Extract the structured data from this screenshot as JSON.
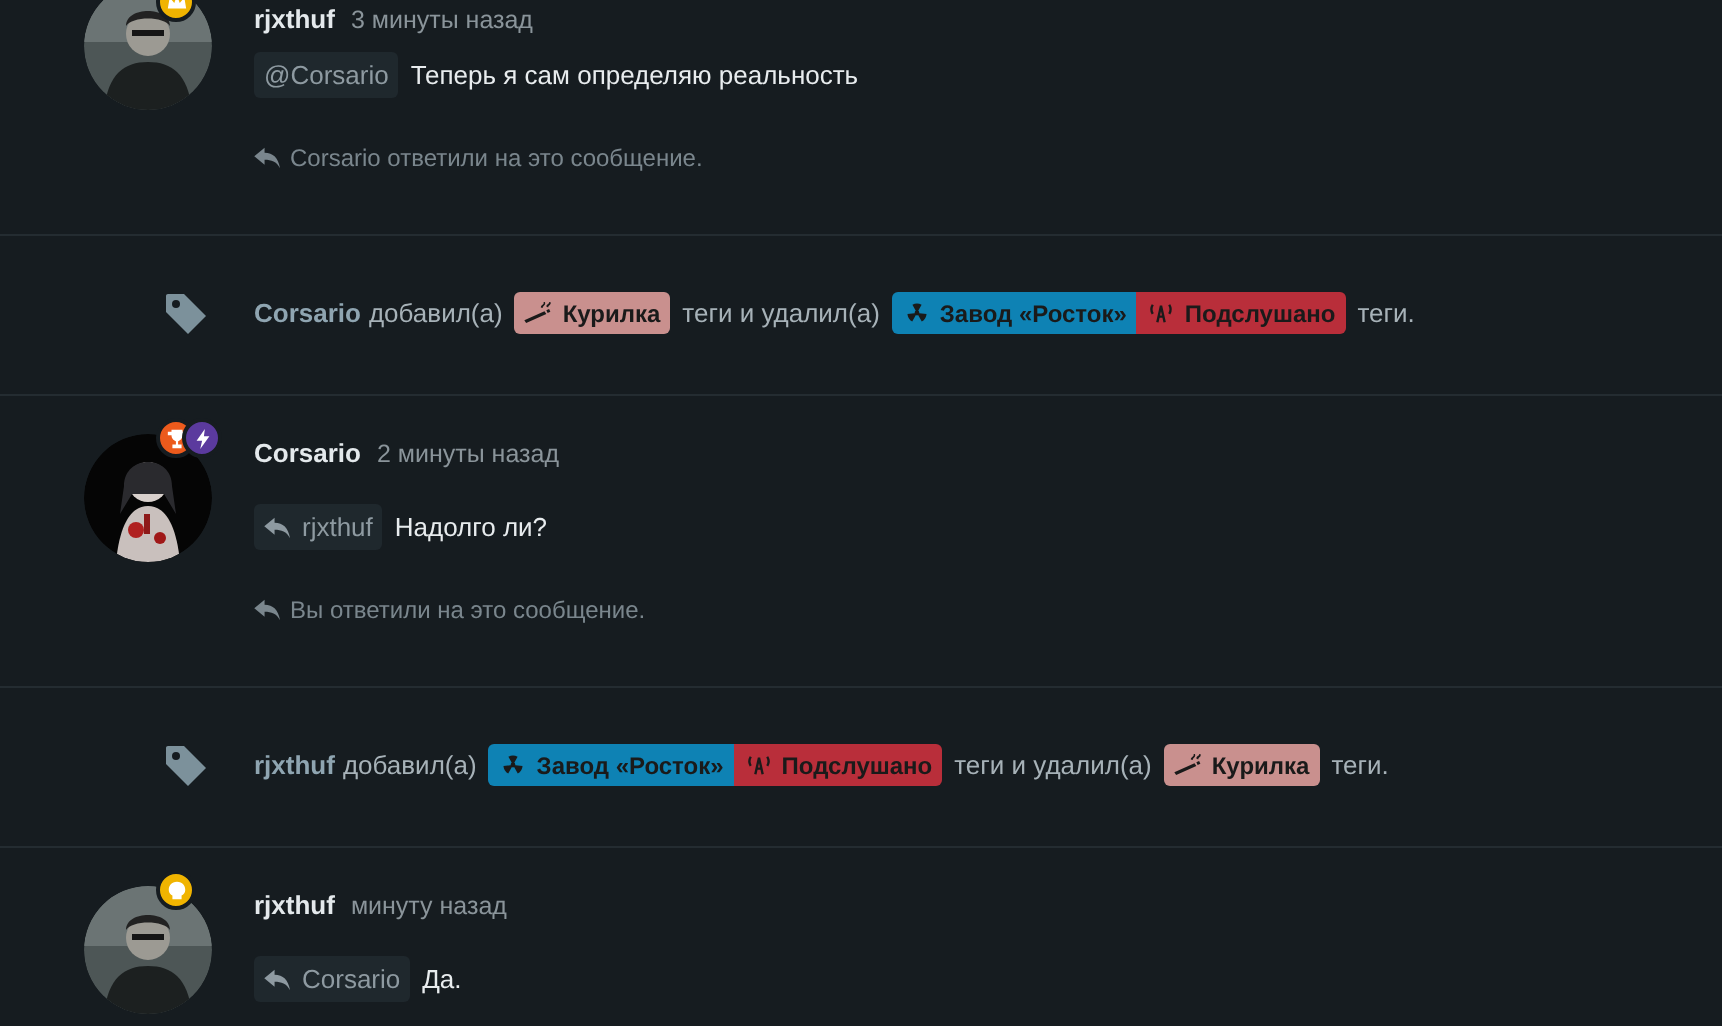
{
  "feed": [
    {
      "kind": "post",
      "author": "rjxthuf",
      "time": "3 минуты назад",
      "badges": [
        {
          "kind": "crown",
          "color": "#f0b400"
        }
      ],
      "reply": {
        "kind": "mention",
        "text": "@Corsario"
      },
      "text": "Теперь я сам определяю реальность",
      "note": "Corsario ответили на это сообщение."
    },
    {
      "kind": "tags",
      "user": "Corsario",
      "added_label": "добавил(а)",
      "added": [
        {
          "kind": "smoking",
          "label": "Курилка",
          "color": "#c9908e"
        }
      ],
      "middle": "теги и удалил(а)",
      "removed": [
        {
          "kind": "radiation",
          "label": "Завод «Росток»",
          "color": "#0e82b4"
        },
        {
          "kind": "antenna",
          "label": "Подслушано",
          "color": "#b92e3a"
        }
      ],
      "end": "теги."
    },
    {
      "kind": "post",
      "author": "Corsario",
      "time": "2 минуты назад",
      "badges": [
        {
          "kind": "trophy",
          "color": "#ec5a1c"
        },
        {
          "kind": "bolt",
          "color": "#5b3a9e"
        }
      ],
      "reply": {
        "kind": "reply",
        "text": "rjxthuf"
      },
      "text": "Надолго ли?",
      "note": "Вы ответили на это сообщение."
    },
    {
      "kind": "tags",
      "user": "rjxthuf",
      "added_label": "добавил(а)",
      "added": [
        {
          "kind": "radiation",
          "label": "Завод «Росток»",
          "color": "#0e82b4"
        },
        {
          "kind": "antenna",
          "label": "Подслушано",
          "color": "#b92e3a"
        }
      ],
      "middle": "теги и удалил(а)",
      "removed": [
        {
          "kind": "smoking",
          "label": "Курилка",
          "color": "#c9908e"
        }
      ],
      "end": "теги."
    },
    {
      "kind": "post",
      "author": "rjxthuf",
      "time": "минуту назад",
      "badges": [
        {
          "kind": "skull",
          "color": "#f0b400"
        }
      ],
      "reply": {
        "kind": "reply",
        "text": "Corsario"
      },
      "text": "Да."
    }
  ]
}
